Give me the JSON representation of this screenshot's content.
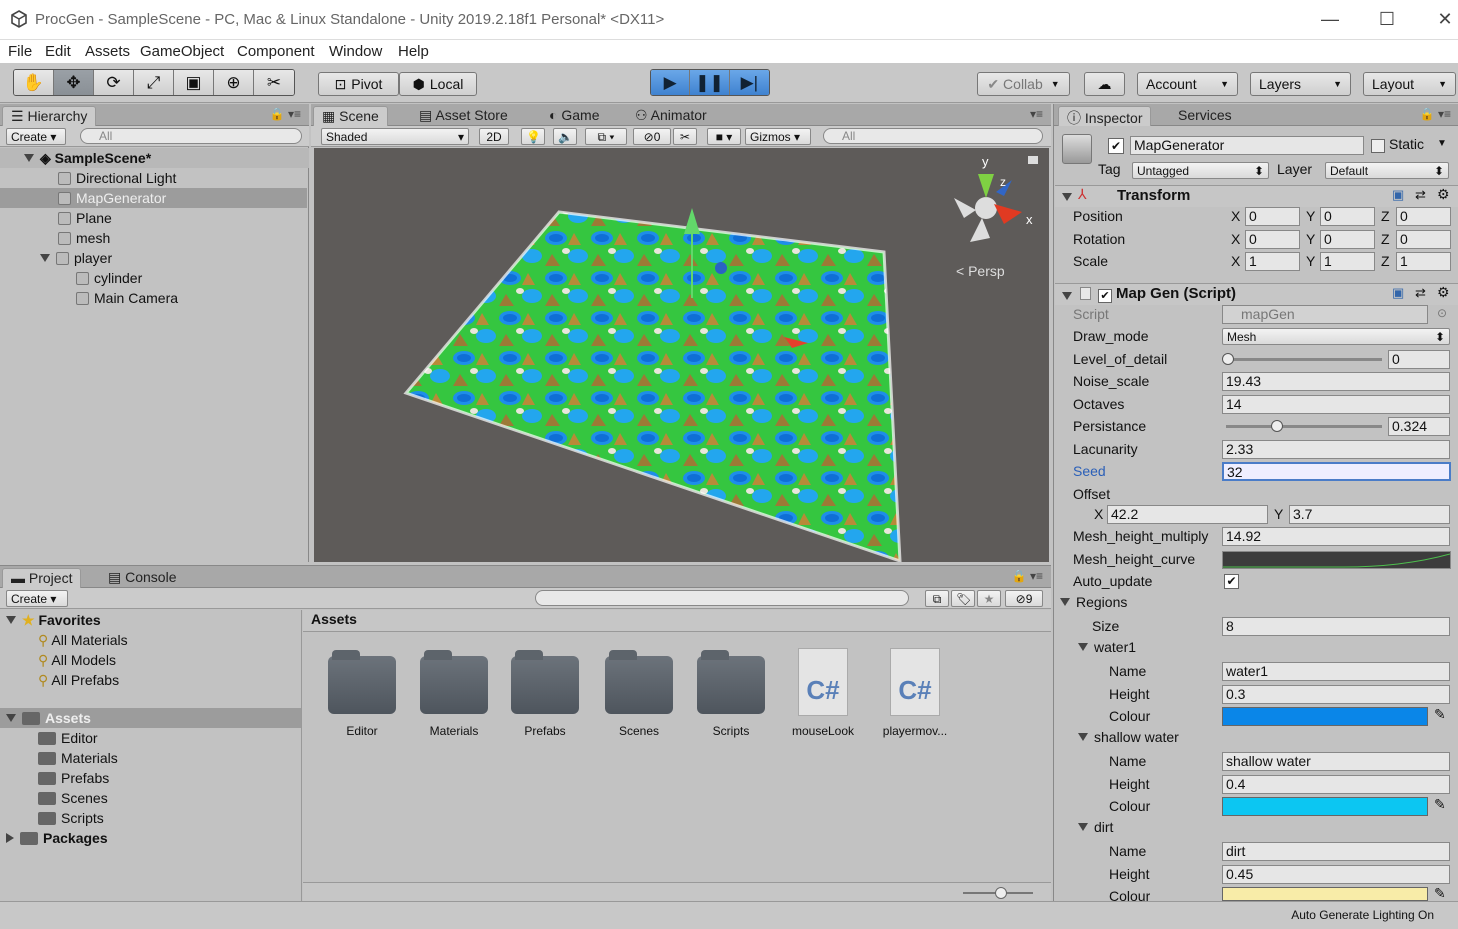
{
  "window": {
    "title": "ProcGen - SampleScene - PC, Mac & Linux Standalone - Unity 2019.2.18f1 Personal* <DX11>",
    "minimize": "—",
    "maximize": "☐",
    "close": "✕"
  },
  "menu": [
    "File",
    "Edit",
    "Assets",
    "GameObject",
    "Component",
    "Window",
    "Help"
  ],
  "toolbar": {
    "pivot": "Pivot",
    "local": "Local",
    "collab": "Collab",
    "account": "Account",
    "layers": "Layers",
    "layout": "Layout"
  },
  "hierarchy": {
    "tab": "Hierarchy",
    "create": "Create",
    "search_placeholder": "All",
    "scene": "SampleScene*",
    "items": [
      "Directional Light",
      "MapGenerator",
      "Plane",
      "mesh",
      "player",
      "cylinder",
      "Main Camera"
    ]
  },
  "scene": {
    "tabs": [
      "Scene",
      "Asset Store",
      "Game",
      "Animator"
    ],
    "shading": "Shaded",
    "mode2d": "2D",
    "hidden_count": "0",
    "gizmos": "Gizmos",
    "search_placeholder": "All",
    "persp": "Persp",
    "axis_y": "y",
    "axis_z": "z",
    "axis_x": "x"
  },
  "project": {
    "tabs": [
      "Project",
      "Console"
    ],
    "create": "Create",
    "filter_count": "9",
    "favorites": "Favorites",
    "favorite_items": [
      "All Materials",
      "All Models",
      "All Prefabs"
    ],
    "assets_root": "Assets",
    "asset_tree": [
      "Editor",
      "Materials",
      "Prefabs",
      "Scenes",
      "Scripts"
    ],
    "packages": "Packages",
    "breadcrumb": "Assets",
    "grid": [
      {
        "name": "Editor",
        "kind": "folder"
      },
      {
        "name": "Materials",
        "kind": "folder"
      },
      {
        "name": "Prefabs",
        "kind": "folder"
      },
      {
        "name": "Scenes",
        "kind": "folder"
      },
      {
        "name": "Scripts",
        "kind": "folder"
      },
      {
        "name": "mouseLook",
        "kind": "script"
      },
      {
        "name": "playermov...",
        "kind": "script"
      }
    ],
    "script_glyph": "C#"
  },
  "inspector": {
    "tabs": [
      "Inspector",
      "Services"
    ],
    "object_name": "MapGenerator",
    "static_label": "Static",
    "tag_label": "Tag",
    "tag": "Untagged",
    "layer_label": "Layer",
    "layer": "Default",
    "transform": {
      "title": "Transform",
      "position_label": "Position",
      "rotation_label": "Rotation",
      "scale_label": "Scale",
      "position": [
        "0",
        "0",
        "0"
      ],
      "rotation": [
        "0",
        "0",
        "0"
      ],
      "scale": [
        "1",
        "1",
        "1"
      ],
      "axes": [
        "X",
        "Y",
        "Z"
      ]
    },
    "mapgen": {
      "title": "Map Gen (Script)",
      "script_label": "Script",
      "script": "mapGen",
      "draw_mode_label": "Draw_mode",
      "draw_mode": "Mesh",
      "lod_label": "Level_of_detail",
      "lod": "0",
      "lod_fraction": 0,
      "noise_scale_label": "Noise_scale",
      "noise_scale": "19.43",
      "octaves_label": "Octaves",
      "octaves": "14",
      "persistance_label": "Persistance",
      "persistance": "0.324",
      "persistance_fraction": 0.324,
      "lacunarity_label": "Lacunarity",
      "lacunarity": "2.33",
      "seed_label": "Seed",
      "seed": "32",
      "offset_label": "Offset",
      "offset_x": "42.2",
      "offset_y": "3.7",
      "mesh_height_label": "Mesh_height_multiply",
      "mesh_height": "14.92",
      "mesh_curve_label": "Mesh_height_curve",
      "auto_update_label": "Auto_update",
      "regions_label": "Regions",
      "size_label": "Size",
      "size": "8",
      "name_label": "Name",
      "height_label": "Height",
      "colour_label": "Colour",
      "regions": [
        {
          "title": "water1",
          "name": "water1",
          "height": "0.3",
          "colour": "#0a86e8"
        },
        {
          "title": "shallow water",
          "name": "shallow water",
          "height": "0.4",
          "colour": "#0cc6f2"
        },
        {
          "title": "dirt",
          "name": "dirt",
          "height": "0.45",
          "colour": "#f8eca8"
        }
      ]
    }
  },
  "status": "Auto Generate Lighting On"
}
